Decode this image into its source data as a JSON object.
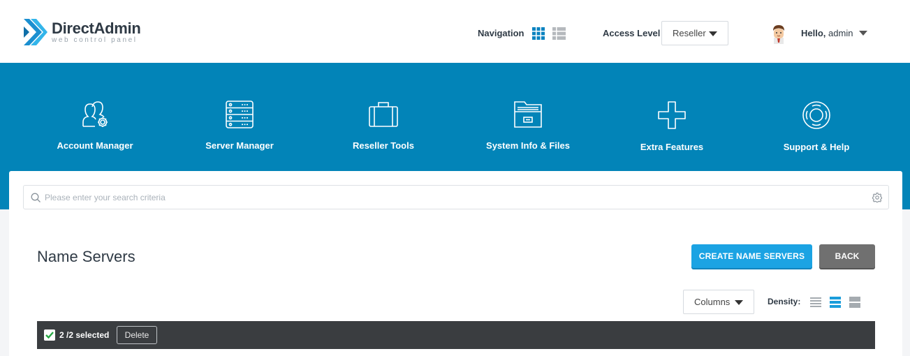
{
  "brand": {
    "name": "DirectAdmin",
    "tagline": "web control panel"
  },
  "header": {
    "navigation_label": "Navigation",
    "access_level_label": "Access Level",
    "access_level_value": "Reseller",
    "greeting": "Hello,",
    "username": "admin"
  },
  "nav": {
    "items": [
      {
        "label": "Account Manager",
        "icon": "users-gear-icon"
      },
      {
        "label": "Server Manager",
        "icon": "server-icon"
      },
      {
        "label": "Reseller Tools",
        "icon": "briefcase-icon"
      },
      {
        "label": "System Info & Files",
        "icon": "folder-icon"
      },
      {
        "label": "Extra Features",
        "icon": "plus-icon"
      },
      {
        "label": "Support & Help",
        "icon": "lifebuoy-icon"
      }
    ]
  },
  "search": {
    "placeholder": "Please enter your search criteria"
  },
  "page": {
    "title": "Name Servers",
    "create_label": "CREATE NAME SERVERS",
    "back_label": "BACK"
  },
  "table": {
    "columns_label": "Columns",
    "density_label": "Density:",
    "density_selected": "medium",
    "selected_text": "2 /2 selected",
    "delete_label": "Delete"
  },
  "colors": {
    "accent": "#0284b8",
    "primary_button": "#1ba3e3",
    "secondary_button": "#707070",
    "toolbar": "#3a3d40"
  }
}
